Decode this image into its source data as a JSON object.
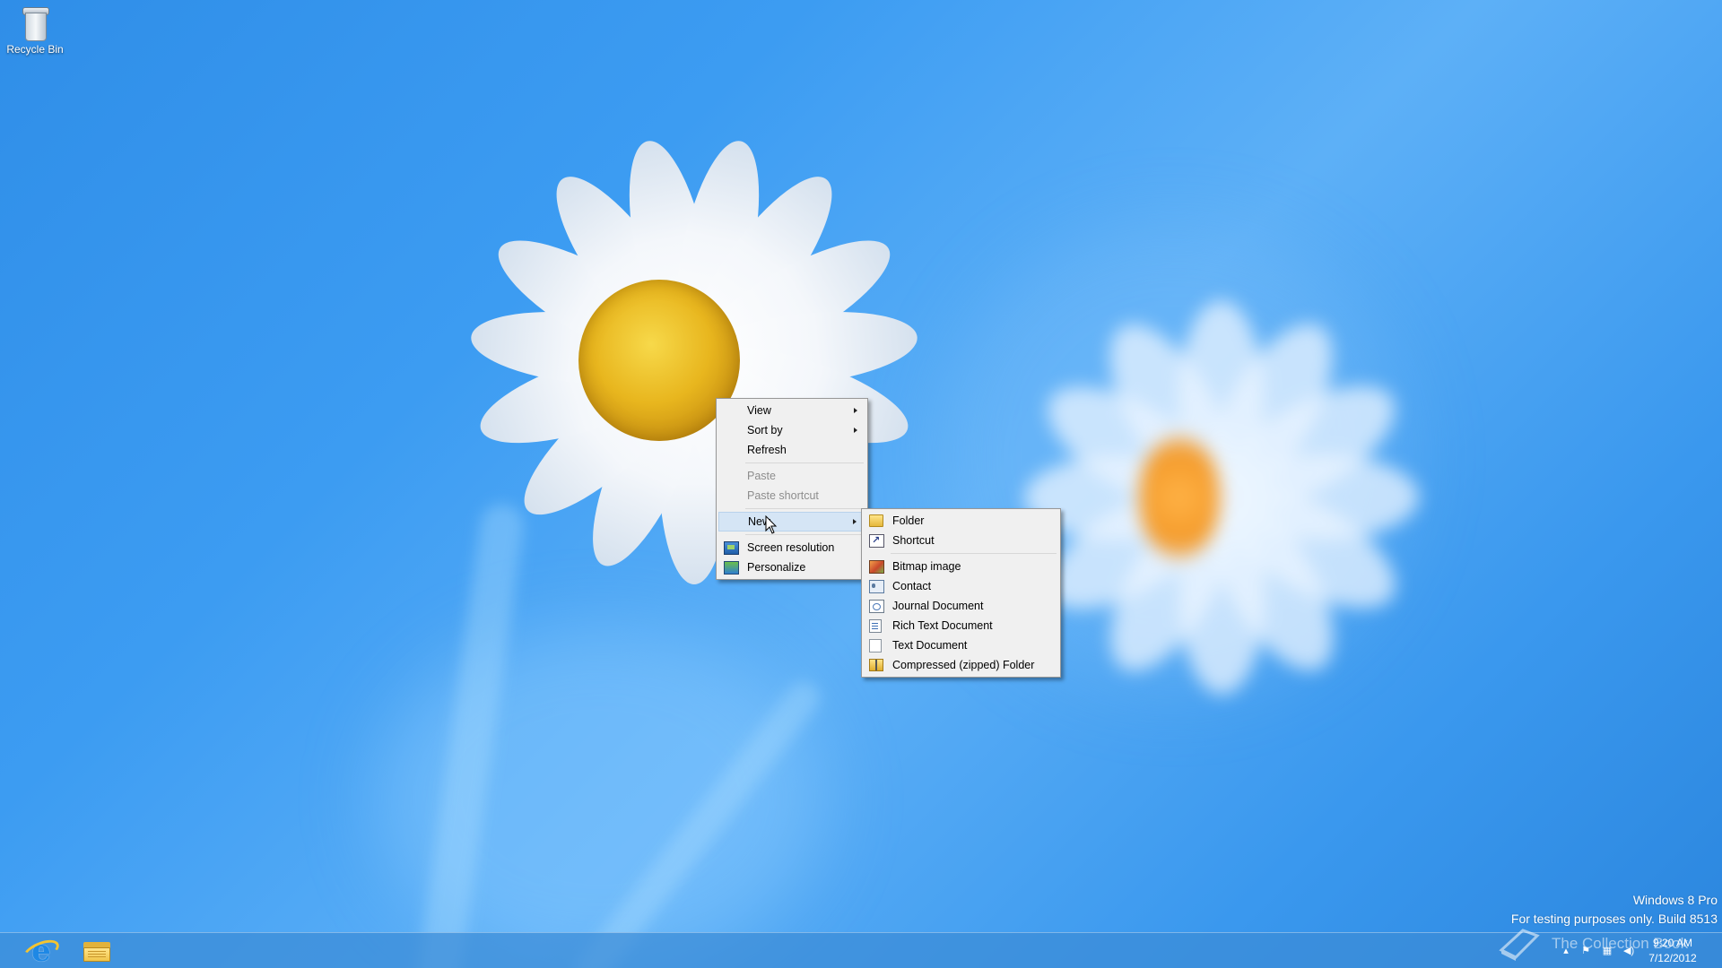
{
  "desktop": {
    "icons": [
      {
        "label": "Recycle Bin",
        "icon": "recycle-bin-icon"
      }
    ]
  },
  "context_menu": {
    "items": [
      {
        "label": "View",
        "submenu": true,
        "enabled": true
      },
      {
        "label": "Sort by",
        "submenu": true,
        "enabled": true
      },
      {
        "label": "Refresh",
        "submenu": false,
        "enabled": true
      },
      {
        "label": "Paste",
        "submenu": false,
        "enabled": false
      },
      {
        "label": "Paste shortcut",
        "submenu": false,
        "enabled": false
      },
      {
        "label": "New",
        "submenu": true,
        "enabled": true,
        "highlighted": true
      },
      {
        "label": "Screen resolution",
        "submenu": false,
        "enabled": true,
        "icon": "screen-resolution-icon"
      },
      {
        "label": "Personalize",
        "submenu": false,
        "enabled": true,
        "icon": "personalize-icon"
      }
    ]
  },
  "new_submenu": {
    "items": [
      {
        "label": "Folder",
        "icon": "folder-icon"
      },
      {
        "label": "Shortcut",
        "icon": "shortcut-icon"
      },
      {
        "label": "Bitmap image",
        "icon": "bitmap-icon"
      },
      {
        "label": "Contact",
        "icon": "contact-icon"
      },
      {
        "label": "Journal Document",
        "icon": "journal-icon"
      },
      {
        "label": "Rich Text Document",
        "icon": "rich-text-icon"
      },
      {
        "label": "Text Document",
        "icon": "text-document-icon"
      },
      {
        "label": "Compressed (zipped) Folder",
        "icon": "zip-folder-icon"
      }
    ]
  },
  "watermark": {
    "edition": "Windows 8 Pro",
    "build": "For testing purposes only. Build 8513"
  },
  "taskbar": {
    "pinned": [
      {
        "name": "Internet Explorer",
        "icon": "internet-explorer-icon"
      },
      {
        "name": "File Explorer",
        "icon": "file-explorer-icon"
      }
    ],
    "tray_icons": [
      "chevron-up-icon",
      "flag-icon",
      "network-icon",
      "volume-icon"
    ],
    "clock": {
      "time": "9:20 AM",
      "date": "7/12/2012"
    }
  },
  "overlay_watermark": {
    "text": "The Collection Book"
  },
  "colors": {
    "accent": "#3c9cf2",
    "menu_bg": "#f0f0f0",
    "menu_highlight": "#d5e5f5"
  }
}
